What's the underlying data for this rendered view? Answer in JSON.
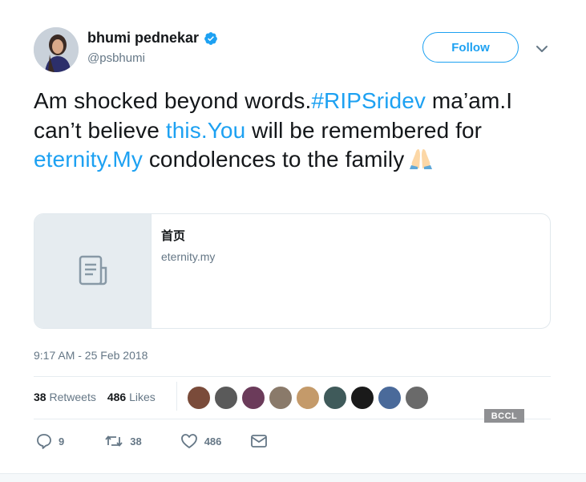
{
  "user": {
    "name": "bhumi pednekar",
    "handle": "@psbhumi"
  },
  "follow_label": "Follow",
  "tweet": {
    "seg1": "Am shocked beyond words.",
    "hashtag": "#RIPSridev",
    "seg2": " ma’am.I can’t believe ",
    "link1": "this.You",
    "seg3": " will be remembered for ",
    "link2": "eternity.My",
    "seg4": " condolences to the family"
  },
  "card": {
    "title": "首页",
    "domain": "eternity.my"
  },
  "timestamp": "9:17 AM - 25 Feb 2018",
  "stats": {
    "retweets_count": "38",
    "retweets_label": "Retweets",
    "likes_count": "486",
    "likes_label": "Likes"
  },
  "watermark": "BCCL",
  "actions": {
    "replies": "9",
    "retweets": "38",
    "likes": "486"
  },
  "colors": {
    "accent": "#1da1f2",
    "muted": "#657786",
    "text": "#14171a"
  }
}
